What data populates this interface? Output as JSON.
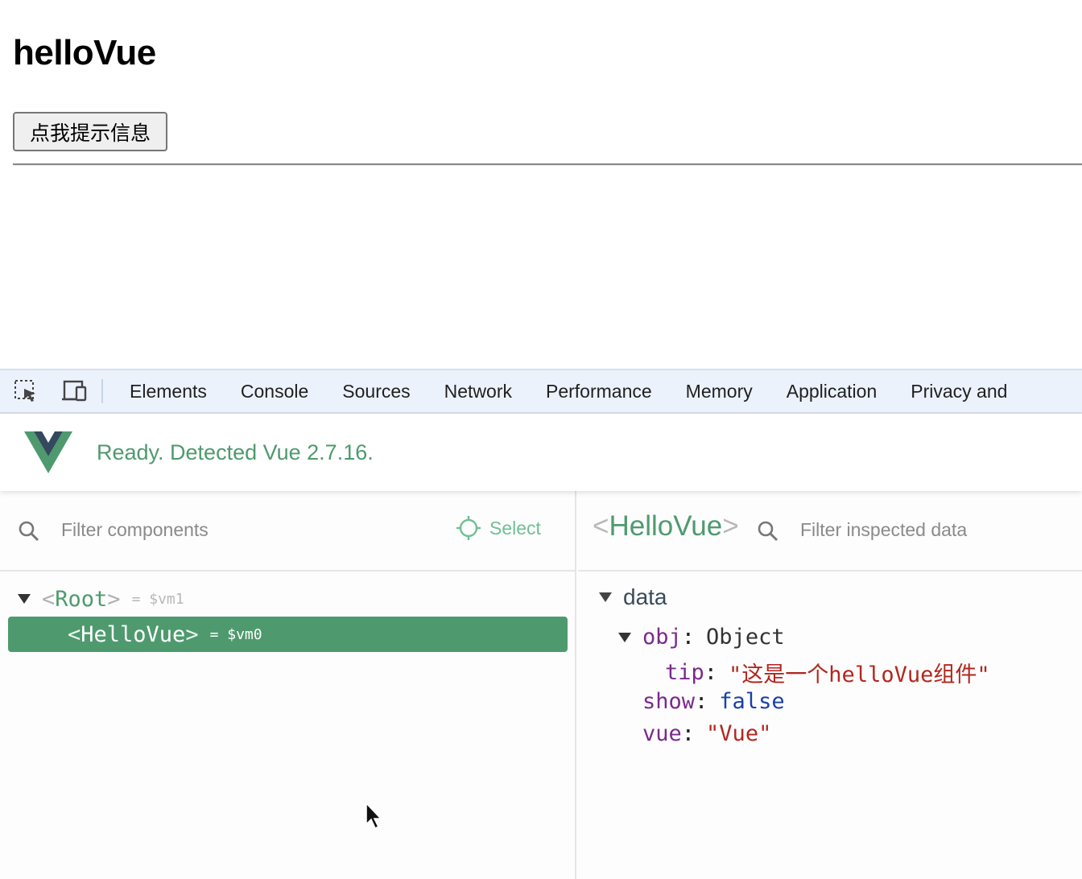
{
  "page": {
    "title": "helloVue",
    "button_label": "点我提示信息"
  },
  "devtools": {
    "tabs": [
      "Elements",
      "Console",
      "Sources",
      "Network",
      "Performance",
      "Memory",
      "Application",
      "Privacy and"
    ],
    "icons": [
      "inspect-element-icon",
      "device-toolbar-icon"
    ]
  },
  "vue": {
    "status": "Ready. Detected Vue 2.7.16.",
    "accent_color": "#4e9a6e",
    "components_panel": {
      "filter_placeholder": "Filter components",
      "select_label": "Select",
      "tree": {
        "root": {
          "open": "<",
          "name": "Root",
          "close": ">",
          "ref": "= $vm1"
        },
        "child": {
          "open": "<",
          "name": "HelloVue",
          "close": ">",
          "ref": "= $vm0",
          "selected": true
        }
      }
    },
    "inspector_panel": {
      "open": "<",
      "component": "HelloVue",
      "close": ">",
      "filter_placeholder": "Filter inspected data",
      "section": "data",
      "props": {
        "obj": {
          "key": "obj",
          "value": "Object"
        },
        "tip": {
          "key": "tip",
          "value": "\"这是一个helloVue组件\""
        },
        "show": {
          "key": "show",
          "value": "false"
        },
        "vue": {
          "key": "vue",
          "value": "\"Vue\""
        }
      }
    }
  }
}
